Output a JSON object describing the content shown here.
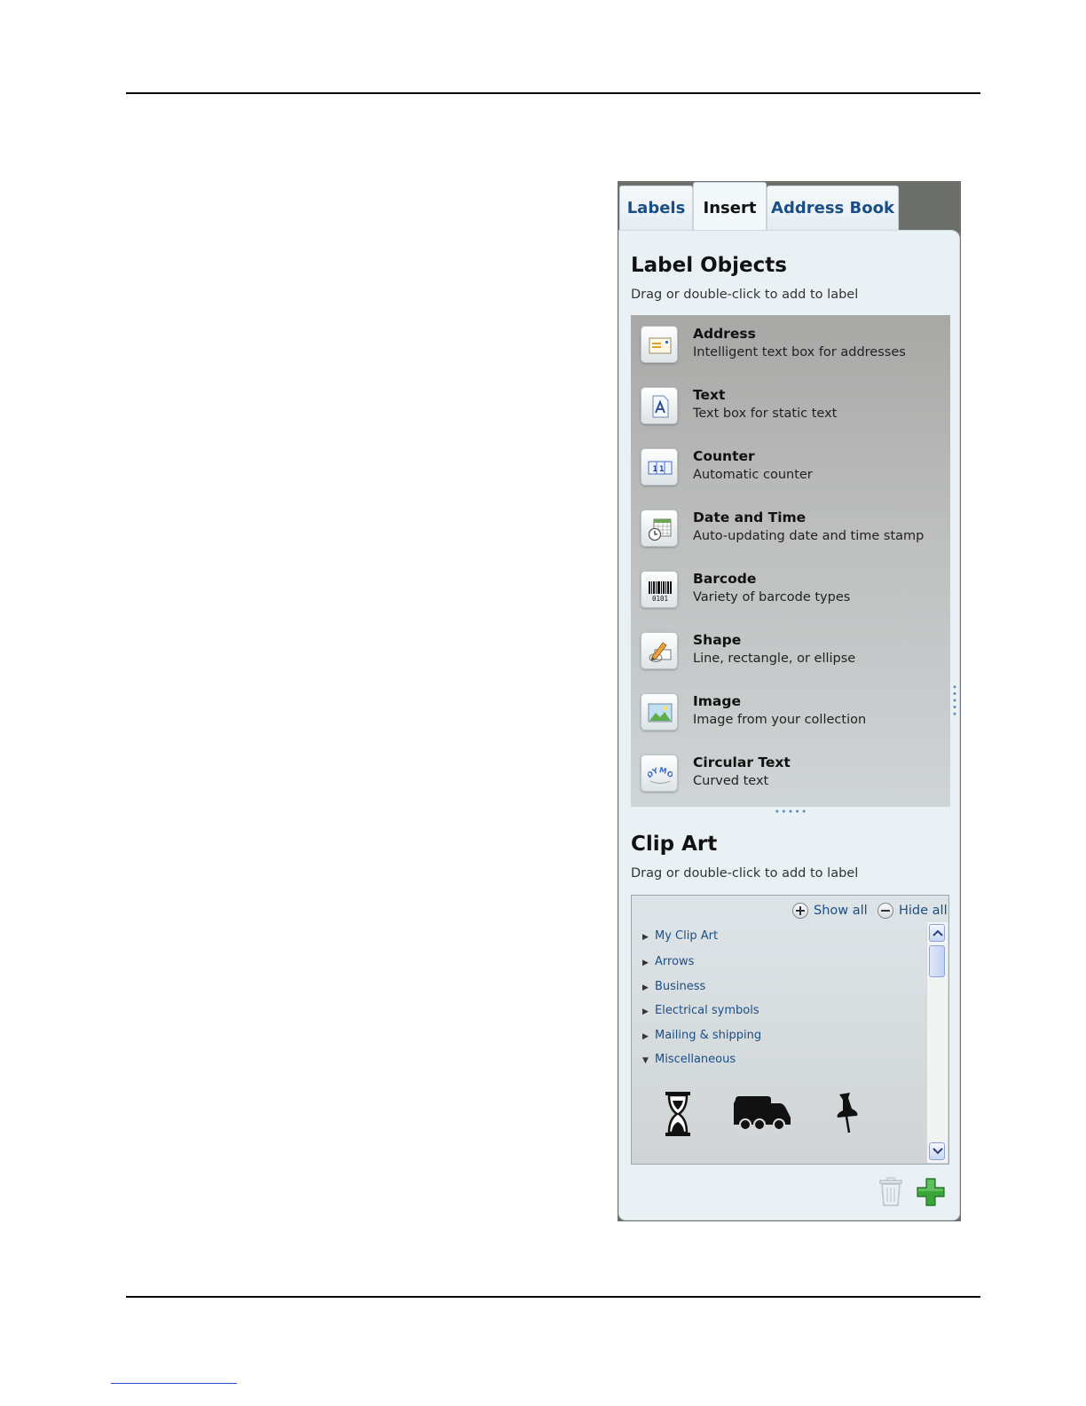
{
  "tabs": [
    {
      "label": "Labels"
    },
    {
      "label": "Insert"
    },
    {
      "label": "Address Book"
    }
  ],
  "active_tab": "Insert",
  "label_objects": {
    "title": "Label Objects",
    "subtitle": "Drag or double-click to add to label",
    "items": [
      {
        "name": "Address",
        "desc": "Intelligent text box for addresses",
        "icon": "address-icon"
      },
      {
        "name": "Text",
        "desc": "Text box for static text",
        "icon": "text-icon"
      },
      {
        "name": "Counter",
        "desc": "Automatic counter",
        "icon": "counter-icon"
      },
      {
        "name": "Date and Time",
        "desc": "Auto-updating date and time stamp",
        "icon": "calendar-clock-icon"
      },
      {
        "name": "Barcode",
        "desc": "Variety of barcode types",
        "icon": "barcode-icon"
      },
      {
        "name": "Shape",
        "desc": "Line, rectangle, or ellipse",
        "icon": "pencil-shape-icon"
      },
      {
        "name": "Image",
        "desc": "Image from your collection",
        "icon": "picture-icon"
      },
      {
        "name": "Circular Text",
        "desc": "Curved text",
        "icon": "curved-text-icon"
      }
    ]
  },
  "clip_art": {
    "title": "Clip Art",
    "subtitle": "Drag or double-click to add to label",
    "show_all": "Show all",
    "hide_all": "Hide all",
    "categories": [
      {
        "label": "My Clip Art",
        "expanded": false
      },
      {
        "label": "Arrows",
        "expanded": false
      },
      {
        "label": "Business",
        "expanded": false
      },
      {
        "label": "Electrical symbols",
        "expanded": false
      },
      {
        "label": "Mailing & shipping",
        "expanded": false
      },
      {
        "label": "Miscellaneous",
        "expanded": true
      }
    ],
    "thumbnails": [
      "hourglass-icon",
      "truck-icon",
      "pushpin-icon"
    ]
  },
  "icon_text": {
    "counter": "11",
    "barcode": "0101",
    "circular": "DYMO"
  },
  "colors": {
    "link": "#1a4f86",
    "panel_bg": "#eaf1f4",
    "frame": "#6d6f6b",
    "add_green": "#3aa53a"
  }
}
